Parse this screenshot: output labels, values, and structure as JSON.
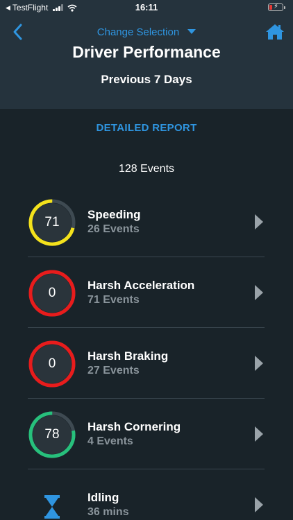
{
  "status_bar": {
    "back_app": "TestFlight",
    "time": "16:11"
  },
  "nav": {
    "change_selection": "Change Selection",
    "title": "Driver Performance",
    "subtitle": "Previous 7 Days",
    "back_icon": "chevron-left-icon",
    "home_icon": "home-icon"
  },
  "detailed_report": "DETAILED REPORT",
  "total_events": "128 Events",
  "colors": {
    "accent": "#2f95e0",
    "yellow": "#f4e21c",
    "red": "#e81c1c",
    "green": "#27c07c",
    "track": "#3e4a52"
  },
  "categories": [
    {
      "name": "Speeding",
      "sub": "26 Events",
      "score": "71",
      "level": 0.71,
      "color": "#f4e21c"
    },
    {
      "name": "Harsh Acceleration",
      "sub": "71 Events",
      "score": "0",
      "level": 1.0,
      "color": "#e81c1c"
    },
    {
      "name": "Harsh Braking",
      "sub": "27 Events",
      "score": "0",
      "level": 1.0,
      "color": "#e81c1c"
    },
    {
      "name": "Harsh Cornering",
      "sub": "4 Events",
      "score": "78",
      "level": 0.78,
      "color": "#27c07c"
    },
    {
      "name": "Idling",
      "sub": "36 mins",
      "icon": "hourglass-icon"
    }
  ]
}
